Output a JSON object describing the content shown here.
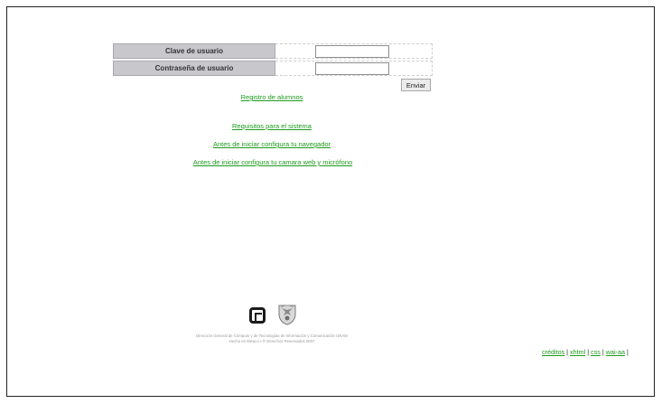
{
  "login": {
    "user_label": "Clave de usuario",
    "password_label": "Contraseña de usuario",
    "user_value": "",
    "password_value": "",
    "submit_label": "Enviar"
  },
  "links": {
    "registro": "Registro de alumnos",
    "requisitos": "Requisitos para el sistema",
    "navegador": "Antes de iniciar configura tu navegador",
    "camara": "Antes de iniciar configura tu camara web y micrófono"
  },
  "footer": {
    "line1": "Dirección General de Cómputo y de Tecnologías de Información y Comunicación UNAM",
    "line2": "Hecho en México • ® Derechos Reservados 2007",
    "links": [
      "créditos",
      "xhtml",
      "css",
      "wai-aa"
    ],
    "separator": "|"
  },
  "colors": {
    "link": "#1d9b1d",
    "label_bg": "#c8c8cc"
  },
  "icons": [
    "dgtic-logo-icon",
    "unam-shield-icon"
  ]
}
